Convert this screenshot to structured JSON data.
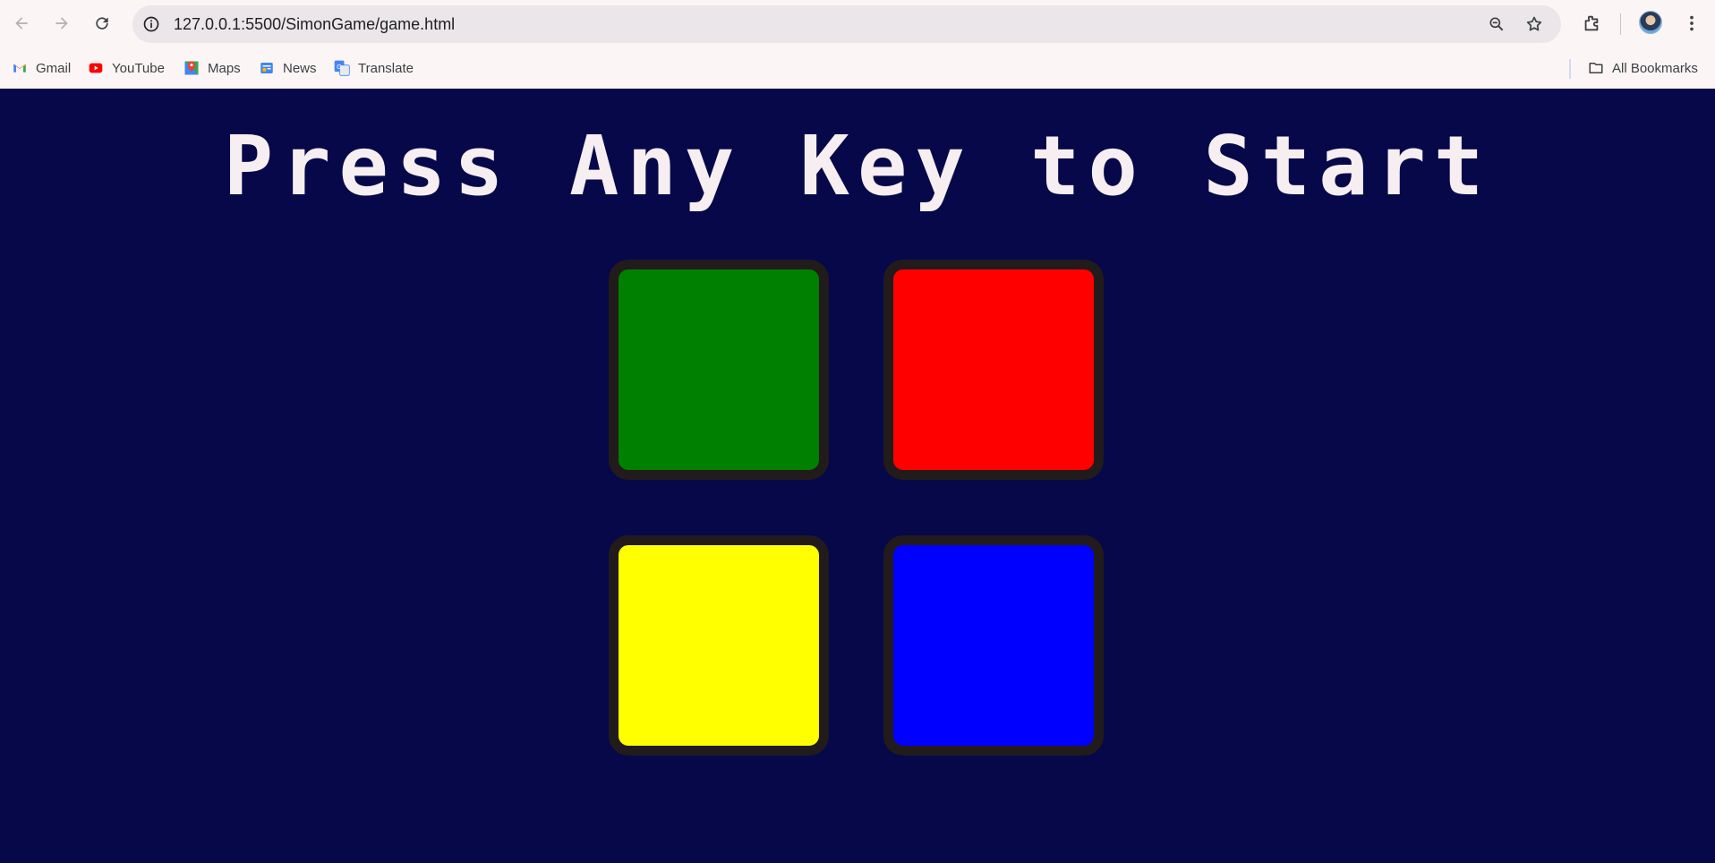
{
  "browser": {
    "url": "127.0.0.1:5500/SimonGame/game.html",
    "bookmarks": [
      {
        "label": "Gmail",
        "icon": "gmail-icon"
      },
      {
        "label": "YouTube",
        "icon": "youtube-icon"
      },
      {
        "label": "Maps",
        "icon": "maps-icon"
      },
      {
        "label": "News",
        "icon": "news-icon"
      },
      {
        "label": "Translate",
        "icon": "translate-icon"
      }
    ],
    "all_bookmarks_label": "All Bookmarks"
  },
  "game": {
    "title": "Press Any Key to Start",
    "buttons": [
      {
        "id": "green",
        "color": "#008000"
      },
      {
        "id": "red",
        "color": "#ff0000"
      },
      {
        "id": "yellow",
        "color": "#ffff00"
      },
      {
        "id": "blue",
        "color": "#0000ff"
      }
    ],
    "background_color": "#060849",
    "border_color": "#221b1c"
  }
}
